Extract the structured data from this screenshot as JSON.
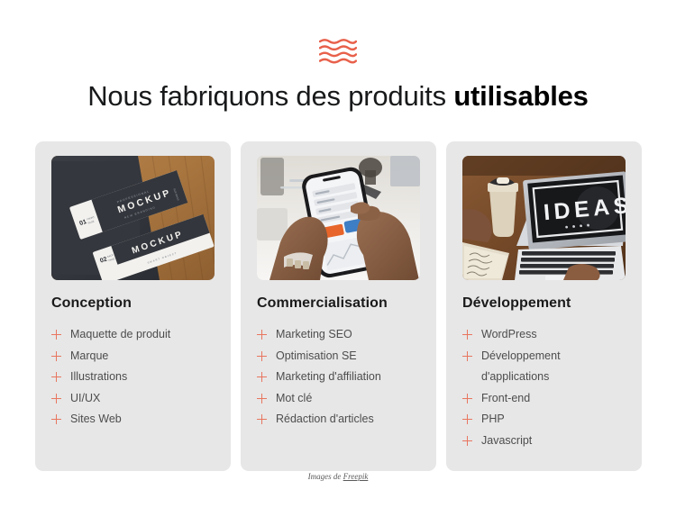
{
  "decoration": {
    "icon": "wavy-lines-icon",
    "color": "#e8604a",
    "wave_count": 4
  },
  "heading": {
    "text_regular": "Nous fabriquons des produits ",
    "text_bold": "utilisables"
  },
  "accent_color": "#e8765f",
  "card_background": "#e7e7e7",
  "cards": [
    {
      "title": "Conception",
      "image_alt": "business-card-mockup-photo",
      "items": [
        "Maquette de produit",
        "Marque",
        "Illustrations",
        "UI/UX",
        "Sites Web"
      ]
    },
    {
      "title": "Commercialisation",
      "image_alt": "hands-holding-smartphone-photo",
      "items": [
        "Marketing SEO",
        "Optimisation SE",
        "Marketing d'affiliation",
        "Mot clé",
        "Rédaction d'articles"
      ]
    },
    {
      "title": "Développement",
      "image_alt": "laptop-ideas-screen-photo",
      "items": [
        "WordPress",
        "Développement d'applications",
        "Front-end",
        "PHP",
        "Javascript"
      ]
    }
  ],
  "credit": {
    "prefix": "Images de ",
    "link_label": "Freepik"
  }
}
